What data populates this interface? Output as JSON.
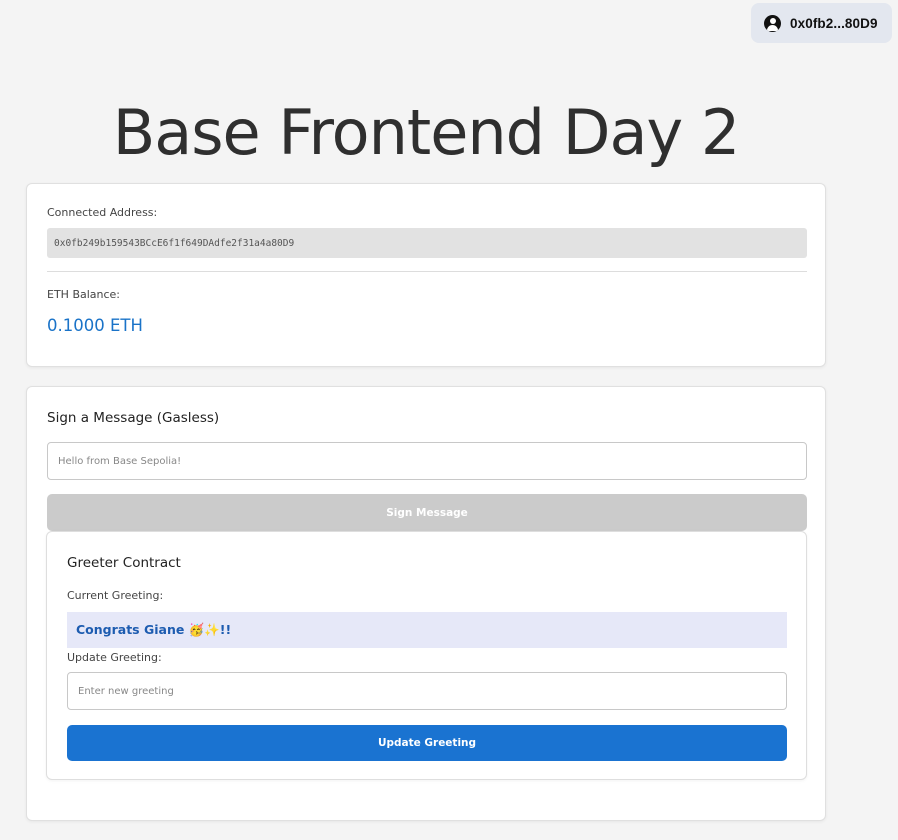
{
  "header": {
    "account_short": "0x0fb2...80D9"
  },
  "page": {
    "title": "Base Frontend Day 2"
  },
  "account_card": {
    "address_label": "Connected Address:",
    "address_value": "0x0fb249b159543BCcE6f1f649DAdfe2f31a4a80D9",
    "balance_label": "ETH Balance:",
    "balance_value": "0.1000 ETH"
  },
  "sign_card": {
    "heading": "Sign a Message (Gasless)",
    "message_placeholder": "Hello from Base Sepolia!",
    "sign_button_label": "Sign Message"
  },
  "greeter": {
    "heading": "Greeter Contract",
    "current_label": "Current Greeting:",
    "current_value": "Congrats Giane 🥳✨!!",
    "update_label": "Update Greeting:",
    "update_placeholder": "Enter new greeting",
    "update_button_label": "Update Greeting"
  },
  "colors": {
    "accent": "#1a73d1",
    "balance_text": "#1a73c8",
    "disabled_button": "#cbcbcb",
    "greeting_bg": "#e6e8f8"
  }
}
